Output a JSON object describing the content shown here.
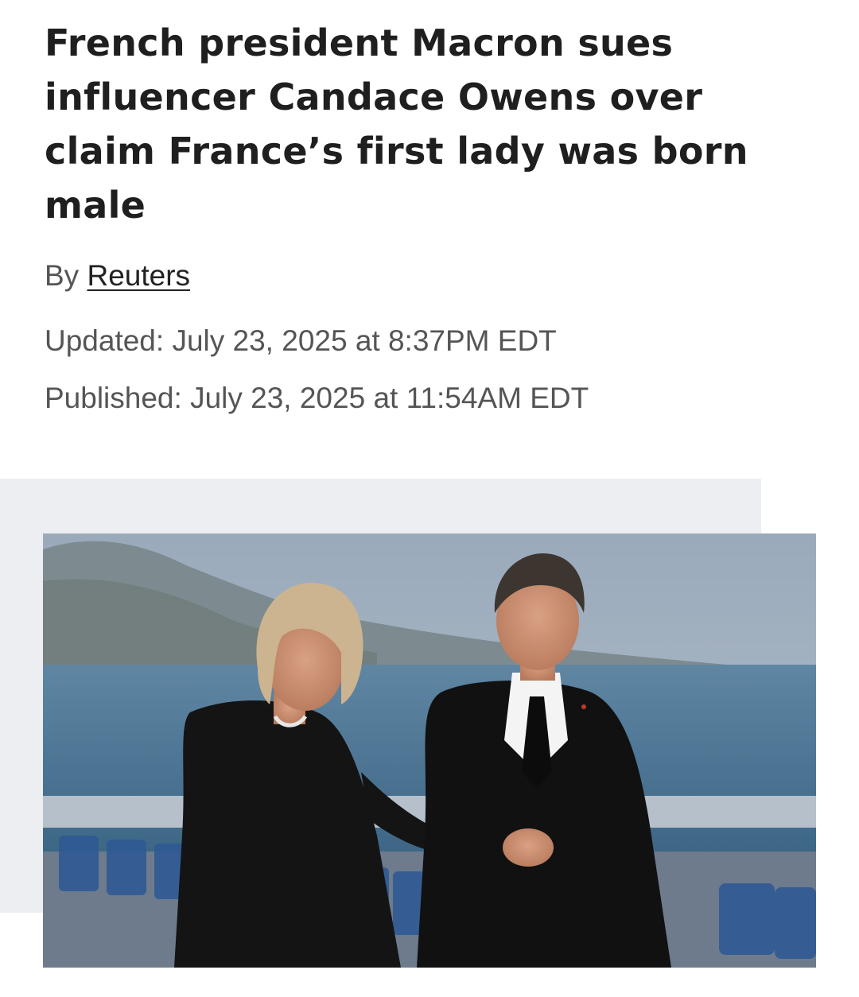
{
  "article": {
    "headline": "French president Macron sues influencer Candace Owens over claim France’s first lady was born male",
    "byline_prefix": "By",
    "author": "Reuters",
    "updated": "Updated: July 23, 2025 at 8:37PM EDT",
    "published": "Published: July 23, 2025 at 11:54AM EDT"
  },
  "media": {
    "icon": "photo-image"
  }
}
